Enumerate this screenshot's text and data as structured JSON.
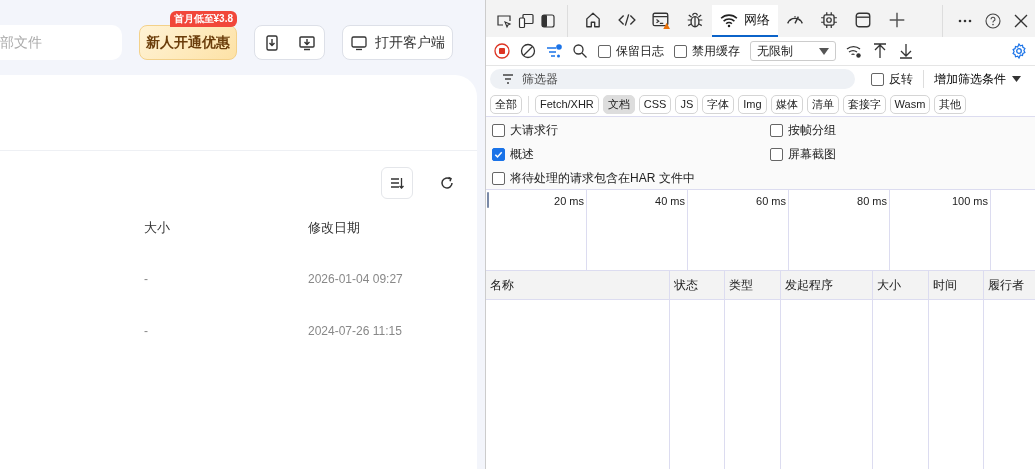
{
  "page": {
    "search": {
      "value": "部文件"
    },
    "promo": {
      "label": "新人开通优惠",
      "badge": "首月低至¥3.8"
    },
    "open_client": "打开客户端",
    "file_table": {
      "columns": [
        "大小",
        "修改日期"
      ],
      "rows": [
        {
          "size": "-",
          "modified": "2026-01-04 09:27"
        },
        {
          "size": "-",
          "modified": "2024-07-26 11:15"
        }
      ]
    }
  },
  "devtools": {
    "left_tools": [
      {
        "kind": "inspect"
      },
      {
        "kind": "device"
      },
      {
        "kind": "dock"
      }
    ],
    "tabs": [
      {
        "kind": "home",
        "selected": false
      },
      {
        "kind": "code",
        "selected": false
      },
      {
        "kind": "console",
        "selected": false
      },
      {
        "kind": "bug",
        "selected": false
      },
      {
        "kind": "network",
        "label": "网络",
        "selected": true
      },
      {
        "kind": "gauge",
        "selected": false
      },
      {
        "kind": "chip",
        "selected": false
      },
      {
        "kind": "window",
        "selected": false
      },
      {
        "kind": "plus",
        "selected": false
      }
    ],
    "toolbar": {
      "preserve_log": {
        "label": "保留日志",
        "checked": false
      },
      "disable_cache": {
        "label": "禁用缓存",
        "checked": false
      },
      "throttling": "无限制"
    },
    "filter": {
      "placeholder": "筛选器",
      "invert": {
        "label": "反转",
        "checked": false
      },
      "more_filters": "增加筛选条件"
    },
    "chips": [
      {
        "label": "全部",
        "selected": false
      },
      {
        "label": "Fetch/XHR",
        "selected": false
      },
      {
        "label": "文档",
        "selected": true
      },
      {
        "label": "CSS",
        "selected": false
      },
      {
        "label": "JS",
        "selected": false
      },
      {
        "label": "字体",
        "selected": false
      },
      {
        "label": "Img",
        "selected": false
      },
      {
        "label": "媒体",
        "selected": false
      },
      {
        "label": "清单",
        "selected": false
      },
      {
        "label": "套接字",
        "selected": false
      },
      {
        "label": "Wasm",
        "selected": false
      },
      {
        "label": "其他",
        "selected": false
      }
    ],
    "options": [
      {
        "label": "大请求行",
        "checked": false
      },
      {
        "label": "按帧分组",
        "checked": false
      },
      {
        "label": "概述",
        "checked": true
      },
      {
        "label": "屏幕截图",
        "checked": false
      },
      {
        "label": "将待处理的请求包含在HAR 文件中",
        "checked": false
      }
    ],
    "overview": {
      "ticks": [
        "20 ms",
        "40 ms",
        "60 ms",
        "80 ms",
        "100 ms"
      ]
    },
    "columns": [
      "名称",
      "状态",
      "类型",
      "发起程序",
      "大小",
      "时间",
      "履行者"
    ]
  }
}
